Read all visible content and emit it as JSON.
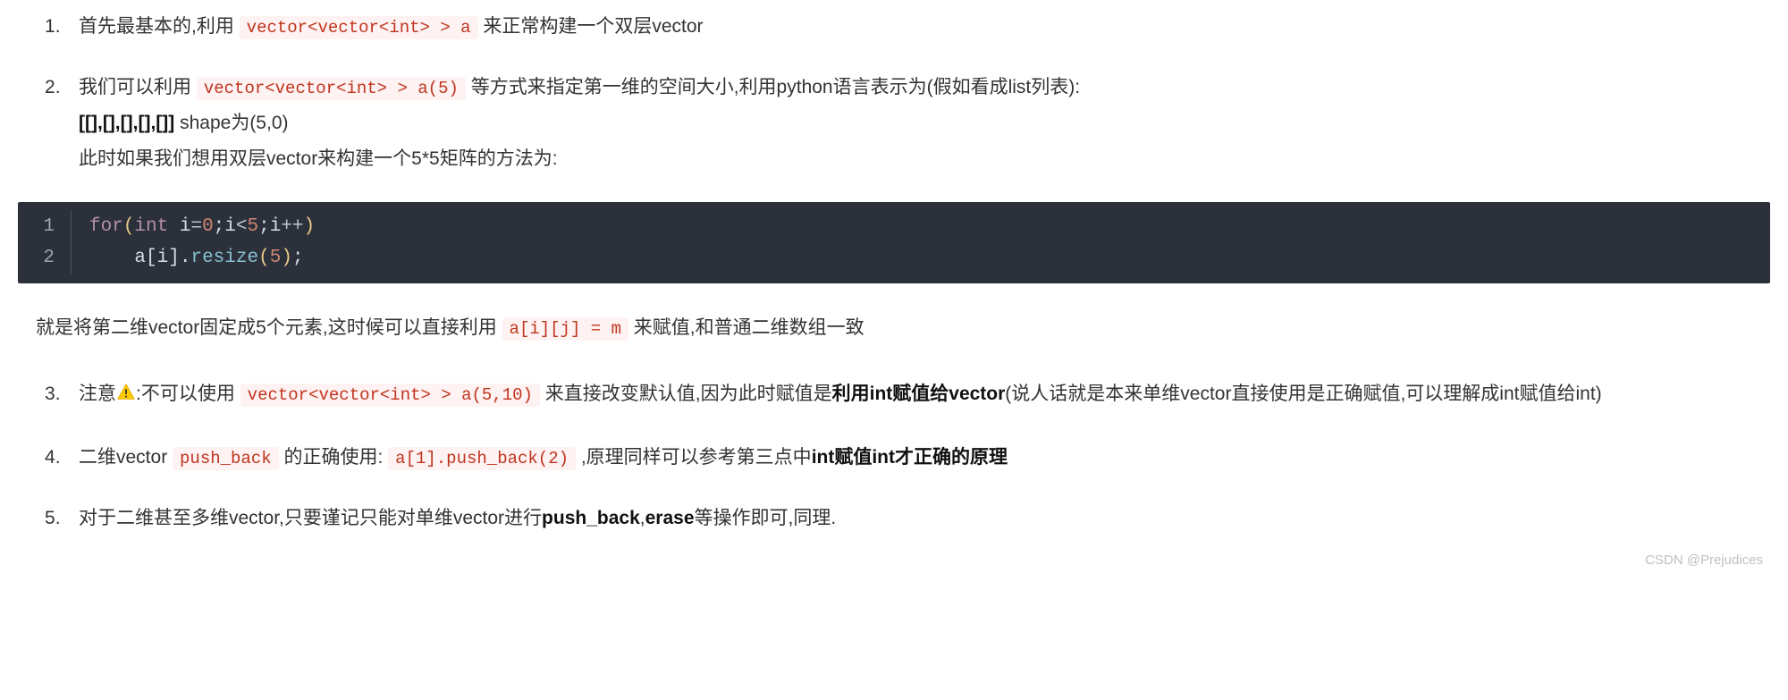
{
  "list1": {
    "item1": {
      "pre": "首先最基本的,利用 ",
      "code": "vector<vector<int> > a",
      "post": " 来正常构建一个双层vector"
    },
    "item2": {
      "pre": "我们可以利用 ",
      "code": "vector<vector<int> > a(5)",
      "post": " 等方式来指定第一维的空间大小,利用python语言表示为(假如看成list列表):",
      "shape_bold": "[[],[],[],[],[]]",
      "shape_text": " shape为(5,0)",
      "line3": "此时如果我们想用双层vector来构建一个5*5矩阵的方法为:"
    }
  },
  "code_block": {
    "line1_num": "1",
    "line2_num": "2",
    "l1": {
      "for": "for",
      "p1": "(",
      "int": "int",
      "sp1": " ",
      "i": "i",
      "eq": "=",
      "zero": "0",
      "sc1": ";",
      "i2": "i",
      "lt": "<",
      "five": "5",
      "sc2": ";",
      "i3": "i",
      "pp": "++",
      "p2": ")"
    },
    "l2": {
      "indent": "    ",
      "a": "a",
      "ob": "[",
      "i": "i",
      "cb": "]",
      "dot": ".",
      "resize": "resize",
      "p1": "(",
      "five": "5",
      "p2": ")",
      "sc": ";"
    }
  },
  "middle_para": {
    "pre": "就是将第二维vector固定成5个元素,这时候可以直接利用 ",
    "code": "a[i][j] = m",
    "post": " 来赋值,和普通二维数组一致"
  },
  "list2": {
    "item3": {
      "pre": "注意",
      "mid1": ":不可以使用 ",
      "code": "vector<vector<int> > a(5,10)",
      "mid2": " 来直接改变默认值,因为此时赋值是",
      "bold": "利用int赋值给vector",
      "post": "(说人话就是本来单维vector直接使用是正确赋值,可以理解成int赋值给int)"
    },
    "item4": {
      "pre": "二维vector ",
      "code1": "push_back",
      "mid1": " 的正确使用: ",
      "code2": "a[1].push_back(2)",
      "mid2": " ,原理同样可以参考第三点中",
      "bold": "int赋值int才正确的原理"
    },
    "item5": {
      "pre": "对于二维甚至多维vector,只要谨记只能对单维vector进行",
      "bold1": "push_back",
      "mid": ",",
      "bold2": "erase",
      "post": "等操作即可,同理."
    }
  },
  "watermark": "CSDN @Prejudices"
}
